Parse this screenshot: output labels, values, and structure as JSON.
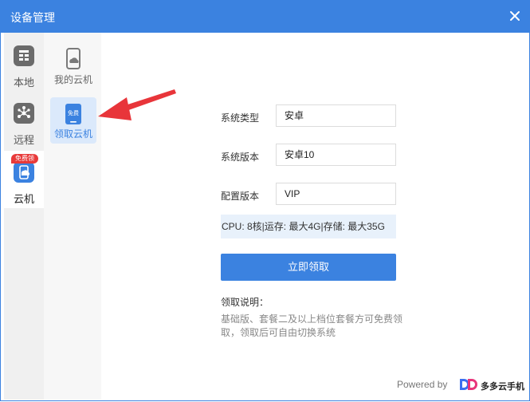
{
  "window": {
    "title": "设备管理"
  },
  "sidebar_primary": {
    "items": [
      {
        "label": "本地",
        "icon": "local-icon"
      },
      {
        "label": "远程",
        "icon": "remote-icon"
      },
      {
        "label": "云机",
        "icon": "cloud-phone-icon",
        "badge": "免费领",
        "active": true
      }
    ]
  },
  "sidebar_secondary": {
    "items": [
      {
        "label": "我的云机",
        "icon": "cloud-device-icon"
      },
      {
        "label": "领取云机",
        "icon": "free-claim-icon",
        "icon_text": "免费",
        "active": true
      }
    ]
  },
  "form": {
    "system_type": {
      "label": "系统类型",
      "value": "安卓"
    },
    "system_version": {
      "label": "系统版本",
      "value": "安卓10"
    },
    "config_version": {
      "label": "配置版本",
      "value": "VIP"
    },
    "spec": "CPU: 8核|运存: 最大4G|存储: 最大35G",
    "claim_button": "立即领取"
  },
  "note": {
    "title": "领取说明：",
    "text": "基础版、套餐二及以上档位套餐方可免费领取，领取后可自由切换系统"
  },
  "footer": {
    "powered_by": "Powered by",
    "brand": "多多云手机"
  },
  "colors": {
    "accent": "#3b82e0",
    "badge": "#e83a3a",
    "arrow": "#e8353a"
  }
}
